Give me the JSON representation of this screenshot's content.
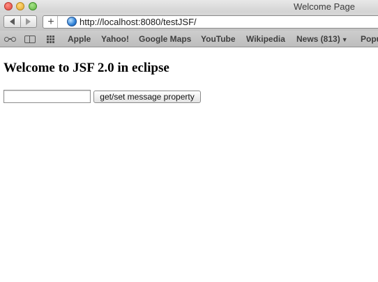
{
  "window": {
    "title": "Welcome Page"
  },
  "toolbar": {
    "add_label": "+",
    "url": "http://localhost:8080/testJSF/"
  },
  "bookmarks": {
    "items": [
      {
        "label": "Apple"
      },
      {
        "label": "Yahoo!"
      },
      {
        "label": "Google Maps"
      },
      {
        "label": "YouTube"
      },
      {
        "label": "Wikipedia"
      },
      {
        "label": "News (813)"
      },
      {
        "label": "Popu"
      }
    ],
    "news_chevron": "▼"
  },
  "page": {
    "heading": "Welcome to JSF 2.0 in eclipse",
    "message_input_value": "",
    "button_label": "get/set message property"
  }
}
